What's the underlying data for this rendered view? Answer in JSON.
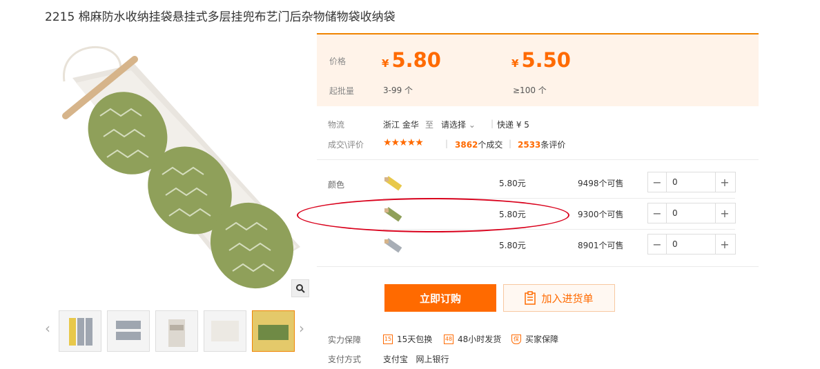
{
  "product": {
    "title": "2215 棉麻防水收纳挂袋悬挂式多层挂兜布艺门后杂物储物袋收纳袋"
  },
  "price": {
    "label": "价格",
    "currency": "¥",
    "tier1": "5.80",
    "tier2": "5.50",
    "moq_label": "起批量",
    "moq1": "3-99 个",
    "moq2": "≥100 个"
  },
  "logistics": {
    "label": "物流",
    "from": "浙江 金华",
    "to_word": "至",
    "select": "请选择",
    "express": "快递 ¥ 5"
  },
  "reviews": {
    "label": "成交\\评价",
    "stars": "★★★★★",
    "rating": 4.5,
    "deals_count": "3862",
    "deals_text": "个成交",
    "review_count": "2533",
    "review_text": "条评价"
  },
  "sku": {
    "label": "颜色",
    "rows": [
      {
        "color_name": "yellow",
        "price": "5.80元",
        "stock": "9498个可售",
        "qty": "0"
      },
      {
        "color_name": "green",
        "price": "5.80元",
        "stock": "9300个可售",
        "qty": "0"
      },
      {
        "color_name": "gray",
        "price": "5.80元",
        "stock": "8901个可售",
        "qty": "0"
      }
    ],
    "minus": "−",
    "plus": "+"
  },
  "actions": {
    "buy_label": "立即订购",
    "cart_label": "加入进货单"
  },
  "guarantee": {
    "label": "实力保障",
    "items": [
      {
        "icon": "15-days-icon",
        "text": "15天包换"
      },
      {
        "icon": "48-hours-icon",
        "text": "48小时发货"
      },
      {
        "icon": "shield-icon",
        "text": "买家保障"
      }
    ]
  },
  "payment": {
    "label": "支付方式",
    "methods": "支付宝   网上银行"
  },
  "colors": {
    "accent": "#ff6a00",
    "highlight_circle": "#d9001b",
    "price_bg": "#fff3e9"
  }
}
